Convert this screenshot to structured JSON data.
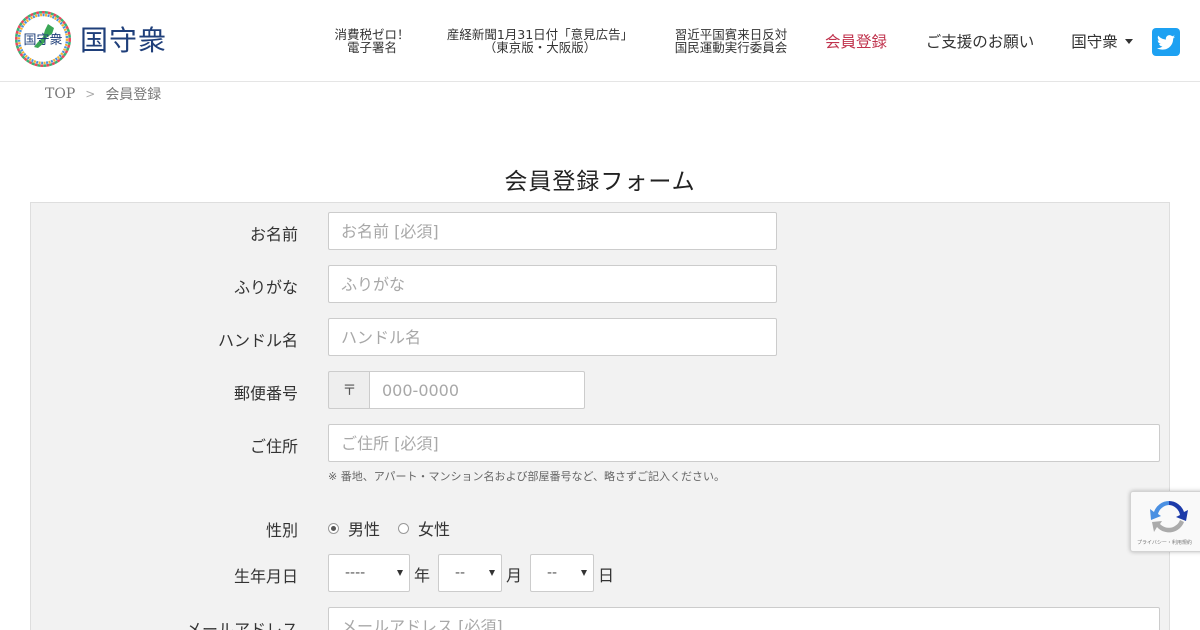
{
  "header": {
    "logo_text": "国守衆",
    "logo_badge": "国守衆",
    "nav": [
      {
        "line1": "消費税ゼロ！",
        "line2": "電子署名"
      },
      {
        "line1": "産経新聞1月31日付「意見広告」",
        "line2": "（東京版・大阪版）"
      },
      {
        "line1": "習近平国賓来日反対",
        "line2": "国民運動実行委員会"
      },
      {
        "label": "会員登録"
      },
      {
        "label": "ご支援のお願い"
      },
      {
        "label": "国守衆"
      }
    ],
    "active_color": "#c0334d",
    "twitter_icon": "twitter-icon",
    "twitter_color": "#1da1f2"
  },
  "breadcrumb": {
    "home": "TOP",
    "separator": ">",
    "current": "会員登録"
  },
  "page_title": "会員登録フォーム",
  "form": {
    "name_label": "お名前",
    "name_placeholder": "お名前 [必須]",
    "furigana_label": "ふりがな",
    "furigana_placeholder": "ふりがな",
    "handle_label": "ハンドル名",
    "handle_placeholder": "ハンドル名",
    "zip_label": "郵便番号",
    "zip_prefix": "〒",
    "zip_placeholder": "000-0000",
    "address_label": "ご住所",
    "address_placeholder": "ご住所 [必須]",
    "address_help": "※ 番地、アパート・マンション名および部屋番号など、略さずご記入ください。",
    "gender_label": "性別",
    "gender_options": [
      "男性",
      "女性"
    ],
    "gender_selected": "男性",
    "birthdate_label": "生年月日",
    "year_value": "----",
    "year_unit": "年",
    "month_value": "--",
    "month_unit": "月",
    "day_value": "--",
    "day_unit": "日",
    "email_label": "メールアドレス",
    "email_placeholder": "メールアドレス [必須]"
  },
  "recaptcha": {
    "footer_text": "プライバシー・利用規約"
  }
}
